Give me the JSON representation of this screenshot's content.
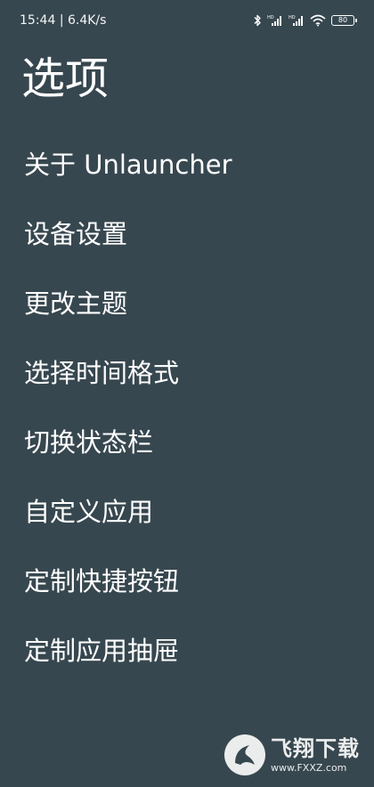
{
  "status_bar": {
    "time": "15:44",
    "net_speed": "6.4K/s",
    "battery": "80"
  },
  "page": {
    "title": "选项"
  },
  "menu": {
    "items": [
      {
        "label": "关于 Unlauncher"
      },
      {
        "label": "设备设置"
      },
      {
        "label": "更改主题"
      },
      {
        "label": "选择时间格式"
      },
      {
        "label": "切换状态栏"
      },
      {
        "label": "自定义应用"
      },
      {
        "label": "定制快捷按钮"
      },
      {
        "label": "定制应用抽屉"
      }
    ]
  },
  "watermark": {
    "title": "飞翔下载",
    "url": "www.FXXZ.com"
  },
  "colors": {
    "background": "#37474f",
    "text": "#ffffff"
  }
}
